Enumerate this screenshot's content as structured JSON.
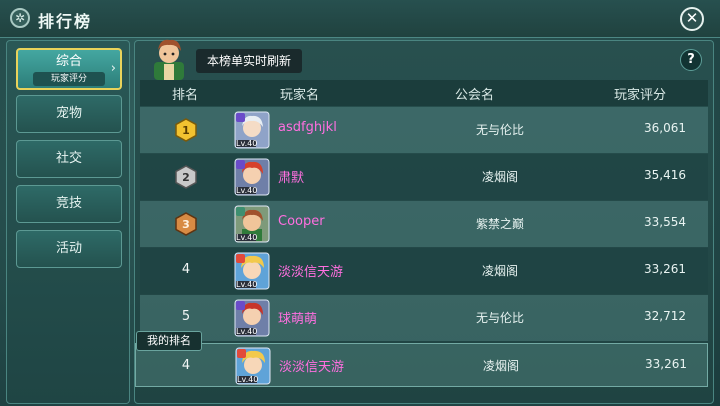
{
  "header": {
    "title": "排行榜",
    "close_label": "✕"
  },
  "sidebar": {
    "items": [
      {
        "label": "综合",
        "sub": "玩家评分",
        "active": true
      },
      {
        "label": "宠物"
      },
      {
        "label": "社交"
      },
      {
        "label": "竞技"
      },
      {
        "label": "活动"
      }
    ]
  },
  "notice": "本榜单实时刷新",
  "help_label": "?",
  "table": {
    "columns": [
      "排名",
      "玩家名",
      "公会名",
      "玩家评分"
    ],
    "rows": [
      {
        "rank": "1",
        "medal": "gold",
        "level": "Lv.40",
        "name": "asdfghjkl",
        "guild": "无与伦比",
        "score": "36,061",
        "avatar": "silver-hair-mage"
      },
      {
        "rank": "2",
        "medal": "silver",
        "level": "Lv.40",
        "name": "肃默",
        "guild": "凌烟阁",
        "score": "35,416",
        "avatar": "red-hair-warrior"
      },
      {
        "rank": "3",
        "medal": "bronze",
        "level": "Lv.40",
        "name": "Cooper",
        "guild": "紫禁之巅",
        "score": "33,554",
        "avatar": "green-armor-hero"
      },
      {
        "rank": "4",
        "level": "Lv.40",
        "name": "淡淡信天游",
        "guild": "凌烟阁",
        "score": "33,261",
        "avatar": "blonde-chibi"
      },
      {
        "rank": "5",
        "level": "Lv.40",
        "name": "球萌萌",
        "guild": "无与伦比",
        "score": "32,712",
        "avatar": "red-hair-girl"
      }
    ]
  },
  "my_rank": {
    "tag": "我的排名",
    "rank": "4",
    "level": "Lv.40",
    "name": "淡淡信天游",
    "guild": "凌烟阁",
    "score": "33,261"
  },
  "colors": {
    "player_name": "#ff6fe0",
    "gold_medal": "#f2c230",
    "silver_medal": "#c9c9c9",
    "bronze_medal": "#d88b44"
  }
}
